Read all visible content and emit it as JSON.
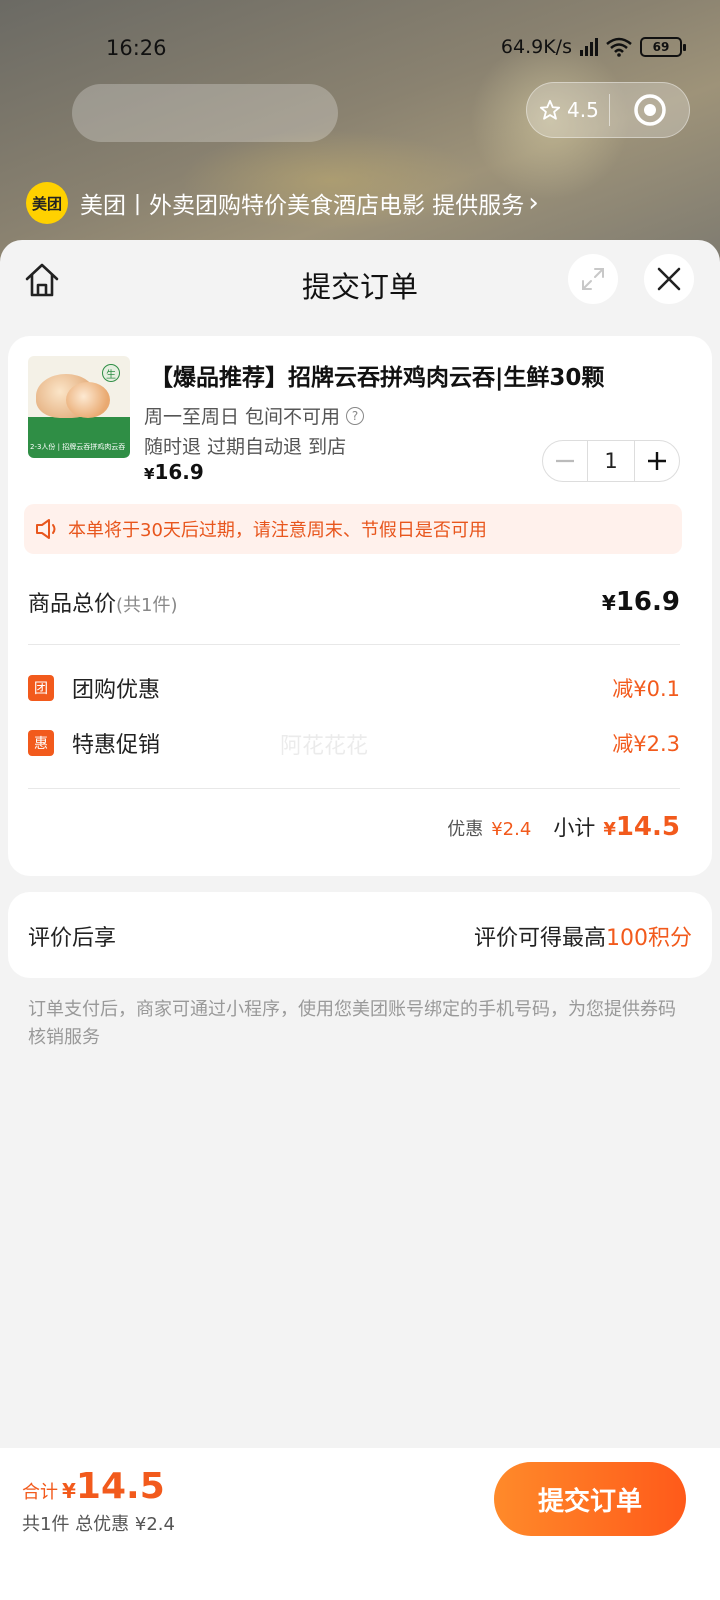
{
  "status_bar": {
    "time": "16:26",
    "network_speed": "64.9K/s",
    "battery": "69"
  },
  "capsule": {
    "rating": "4.5"
  },
  "service": {
    "logo_text": "美团",
    "text": "美团丨外卖团购特价美食酒店电影 提供服务",
    "chevron": "›"
  },
  "sheet": {
    "title": "提交订单"
  },
  "product": {
    "title": "【爆品推荐】招牌云吞拼鸡肉云吞|生鲜30颗",
    "availability": "周一至周日 包间不可用",
    "refund_policy": "随时退 过期自动退 到店",
    "price_currency": "¥",
    "price": "16.9",
    "quantity": "1",
    "thumb_badge": "生",
    "thumb_caption": "2-3人份 | 招牌云吞拼鸡肉云吞"
  },
  "notice": {
    "text": "本单将于30天后过期，请注意周末、节假日是否可用"
  },
  "summary": {
    "total_label": "商品总价",
    "total_count": "(共1件)",
    "total_currency": "¥",
    "total_value": "16.9",
    "discounts": [
      {
        "tag": "团",
        "label": "团购优惠",
        "value": "减¥0.1"
      },
      {
        "tag": "惠",
        "label": "特惠促销",
        "value": "减¥2.3"
      }
    ],
    "watermark": "阿花花花",
    "discount_label": "优惠",
    "discount_value": "¥2.4",
    "subtotal_label": "小计",
    "subtotal_currency": "¥",
    "subtotal_value": "14.5"
  },
  "review": {
    "left": "评价后享",
    "right_prefix": "评价可得最高",
    "right_highlight": "100积分"
  },
  "footnote": "订单支付后，商家可通过小程序，使用您美团账号绑定的手机号码，为您提供券码核销服务",
  "bottom_bar": {
    "sum_label": "合计",
    "sum_currency": "¥",
    "sum_value": "14.5",
    "sub_text": "共1件 总优惠 ¥2.4",
    "submit_label": "提交订单"
  },
  "colors": {
    "accent": "#f25a1c",
    "notice_bg": "#fff1ec",
    "brand_yellow": "#ffd100"
  },
  "icons": [
    "home-icon",
    "expand-icon",
    "close-icon",
    "star-icon",
    "target-icon",
    "speaker-icon",
    "question-icon",
    "wifi-icon",
    "signal-icon",
    "battery-icon"
  ]
}
